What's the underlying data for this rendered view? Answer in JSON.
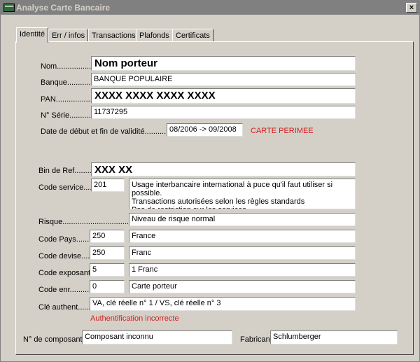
{
  "window": {
    "title": "Analyse Carte Bancaire",
    "close": "×"
  },
  "tabs": [
    "Identité",
    "Err / infos",
    "Transactions",
    "Plafonds",
    "Certificats"
  ],
  "fields": {
    "nom": {
      "label": "Nom.................",
      "value": "Nom porteur"
    },
    "banque": {
      "label": "Banque.............",
      "value": "BANQUE POPULAIRE"
    },
    "pan": {
      "label": "PAN.................",
      "value": "XXXX XXXX XXXX XXXX"
    },
    "serie": {
      "label": "N° Série...........",
      "value": "11737295"
    },
    "validite": {
      "label": "Date de début et fin de validité...........",
      "value": "08/2006 -> 09/2008",
      "status": "CARTE PERIMEE"
    },
    "bin": {
      "label": "Bin de Ref.........",
      "value": "XXX XX"
    },
    "service": {
      "label": "Code service.......",
      "code": "201",
      "desc": "Usage interbancaire international à puce qu'il faut utiliser si possible.\nTransactions autorisées selon les règles standards\nPas de restriction sur les services"
    },
    "risque": {
      "label": "Risque.................................",
      "value": "Niveau de risque normal"
    },
    "pays": {
      "label": "Code Pays.........",
      "code": "250",
      "value": "France"
    },
    "devise": {
      "label": "Code devise.........",
      "code": "250",
      "value": "Franc"
    },
    "exposant": {
      "label": "Code exposant.",
      "code": "5",
      "value": "1 Franc"
    },
    "enr": {
      "label": "Code enr............",
      "code": "0",
      "value": "Carte porteur"
    },
    "cle": {
      "label": "Clé authent.........",
      "value": "VA, clé réelle n° 1 / VS, clé réelle n° 3",
      "status": "Authentification incorrecte"
    },
    "composant": {
      "label": "N° de composant",
      "value": "Composant inconnu"
    },
    "fabricant": {
      "label": "Fabricant",
      "value": "Schlumberger"
    }
  },
  "colors": {
    "status_red": "#d02020",
    "face": "#d4d0c8",
    "titlebar": "#808080"
  }
}
